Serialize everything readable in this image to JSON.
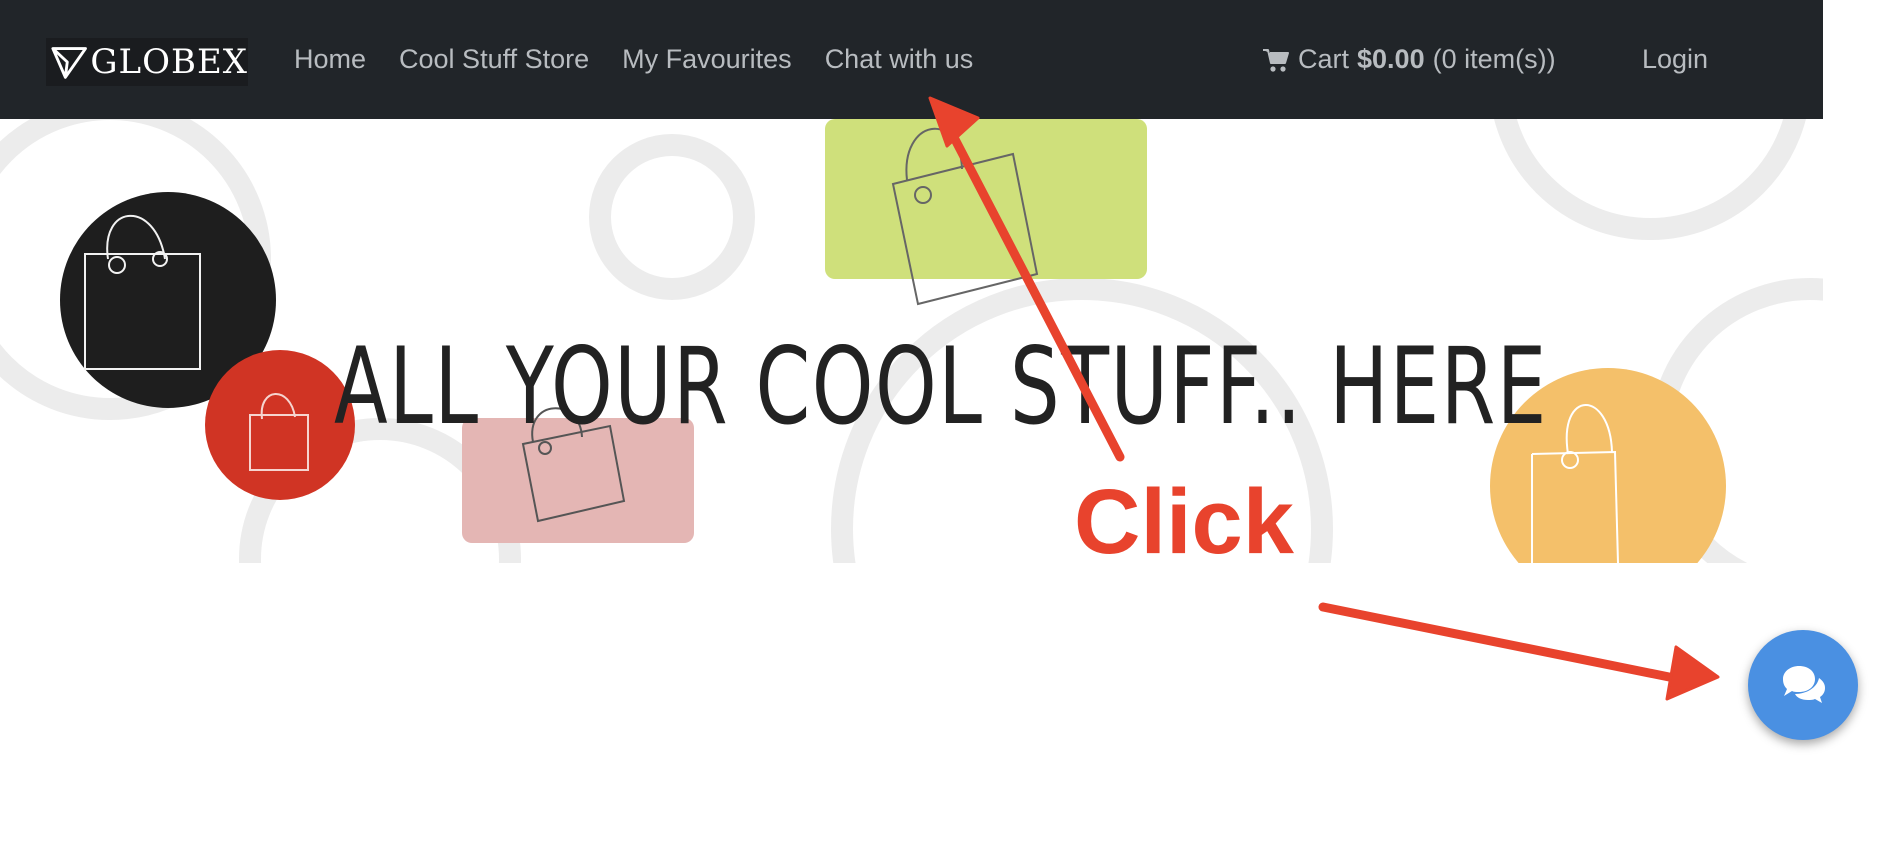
{
  "navbar": {
    "brand": "GLOBEX",
    "links": [
      "Home",
      "Cool Stuff Store",
      "My Favourites",
      "Chat with us"
    ],
    "cart": {
      "label": "Cart",
      "total": "$0.00",
      "items": "(0 item(s))"
    },
    "login": "Login"
  },
  "hero": {
    "headline": "ALL YOUR COOL STUFF.. HERE"
  },
  "annotation": {
    "label": "Click",
    "color": "#e8432d"
  },
  "chat_widget": {
    "icon": "chat-bubbles-icon",
    "color": "#4a90e2"
  },
  "colors": {
    "navbar_bg": "#212529",
    "nav_text": "#b8bcc0",
    "hero_text": "#222222"
  }
}
